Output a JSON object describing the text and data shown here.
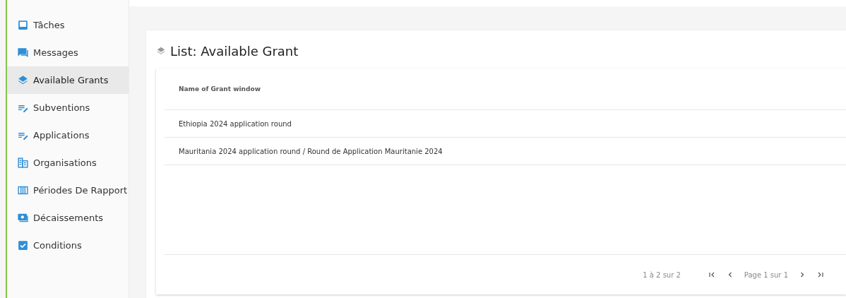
{
  "sidebar": {
    "items": [
      {
        "label": "Tâches",
        "selected": false
      },
      {
        "label": "Messages",
        "selected": false
      },
      {
        "label": "Available Grants",
        "selected": true
      },
      {
        "label": "Subventions",
        "selected": false
      },
      {
        "label": "Applications",
        "selected": false
      },
      {
        "label": "Organisations",
        "selected": false
      },
      {
        "label": "Périodes De Rapport",
        "selected": false
      },
      {
        "label": "Décaissements",
        "selected": false
      },
      {
        "label": "Conditions",
        "selected": false
      }
    ]
  },
  "page": {
    "title": "List: Available Grant"
  },
  "table": {
    "columns": [
      "Name of Grant window"
    ],
    "rows": [
      [
        "Ethiopia 2024 application round"
      ],
      [
        "Mauritania 2024 application round / Round de Application Mauritanie 2024"
      ]
    ]
  },
  "pagination": {
    "range": "1 à 2 sur 2",
    "page": "Page 1 sur 1"
  }
}
